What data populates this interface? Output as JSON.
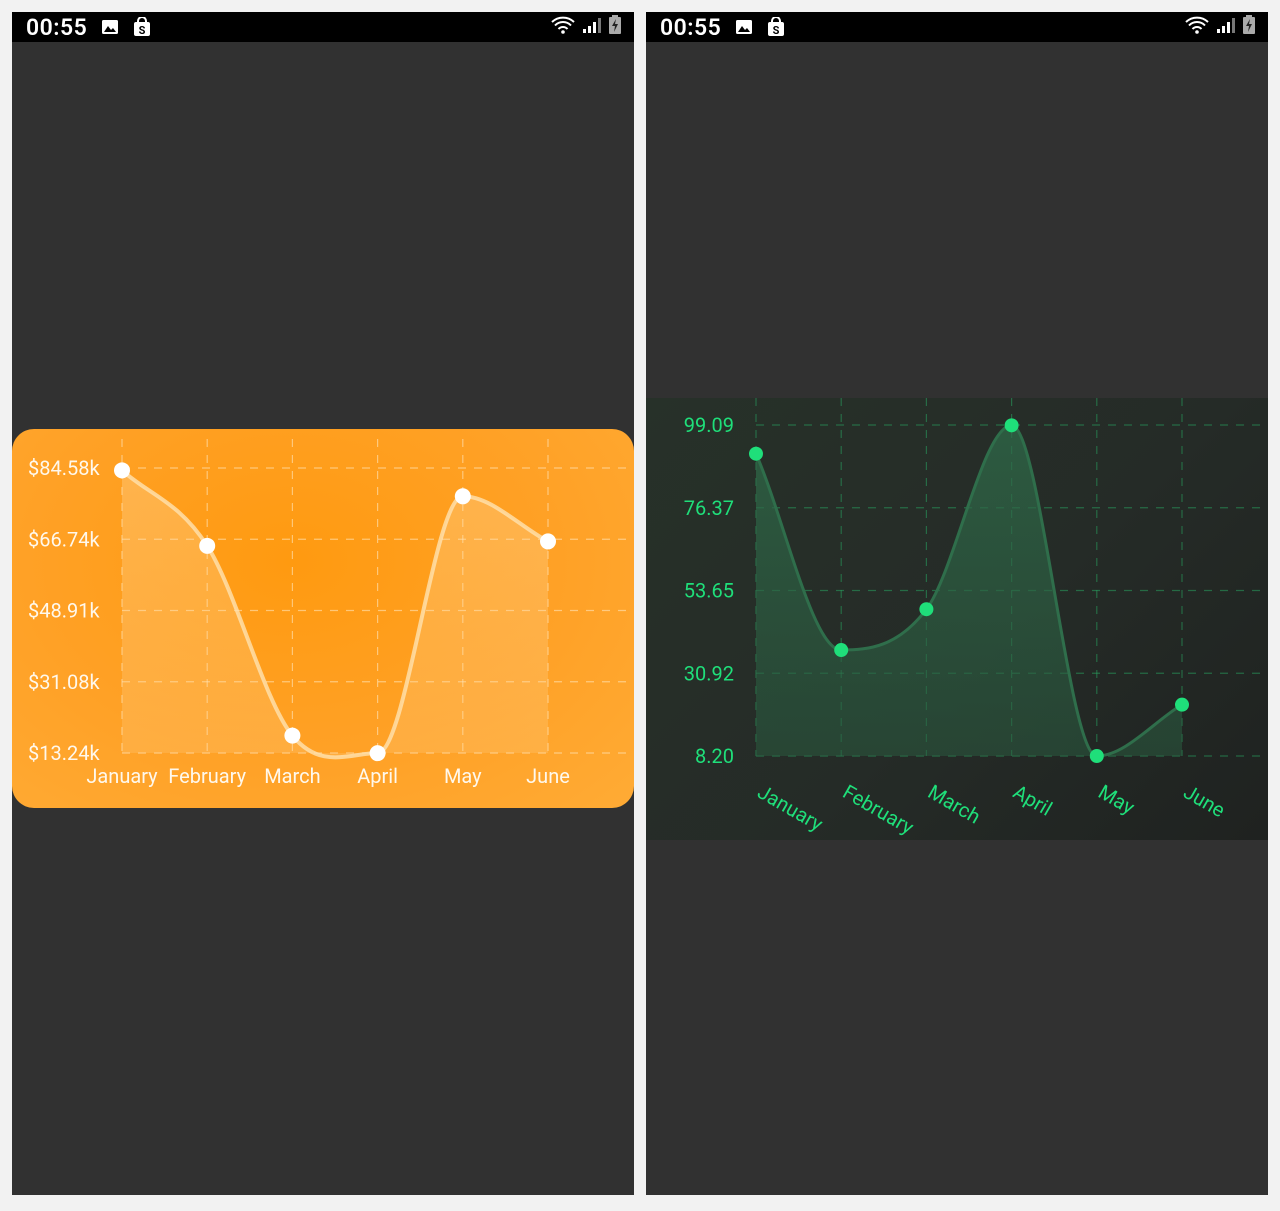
{
  "left_screen": {
    "status_bar": {
      "time": "00:55",
      "icons": [
        "image-icon",
        "shopping-bag-icon",
        "wifi-icon",
        "signal-icon",
        "battery-charging-icon"
      ]
    }
  },
  "right_screen": {
    "status_bar": {
      "time": "00:55",
      "icons": [
        "image-icon",
        "shopping-bag-icon",
        "wifi-icon",
        "signal-icon",
        "battery-charging-icon"
      ]
    }
  },
  "colors": {
    "orange_card": "#ff9d1a",
    "orange_line": "#ffd38a",
    "orange_point": "#ffffff",
    "green_accent": "#1fdf7a",
    "green_line": "#2f6e4b",
    "green_fill": "#2e5a42",
    "background": "#313131"
  },
  "chart_data": [
    {
      "type": "area",
      "style": "orange card, smooth line with filled area",
      "categories": [
        "January",
        "February",
        "March",
        "April",
        "May",
        "June"
      ],
      "y_tick_labels": [
        "$84.58k",
        "$66.74k",
        "$48.91k",
        "$31.08k",
        "$13.24k"
      ],
      "ylim": [
        13.24,
        84.58
      ],
      "unit": "$k",
      "series": [
        {
          "values": [
            84.0,
            65.1,
            17.6,
            13.2,
            77.5,
            66.2
          ]
        }
      ],
      "grid": true
    },
    {
      "type": "area",
      "style": "dark green, smooth line with filled area",
      "categories": [
        "January",
        "February",
        "March",
        "April",
        "May",
        "June"
      ],
      "y_tick_labels": [
        "99.09",
        "76.37",
        "53.65",
        "30.92",
        "8.20"
      ],
      "ylim": [
        8.2,
        99.09
      ],
      "series": [
        {
          "values": [
            91.2,
            37.3,
            48.5,
            99.0,
            8.2,
            22.3
          ]
        }
      ],
      "grid": true,
      "x_label_rotation": "slanted"
    }
  ]
}
